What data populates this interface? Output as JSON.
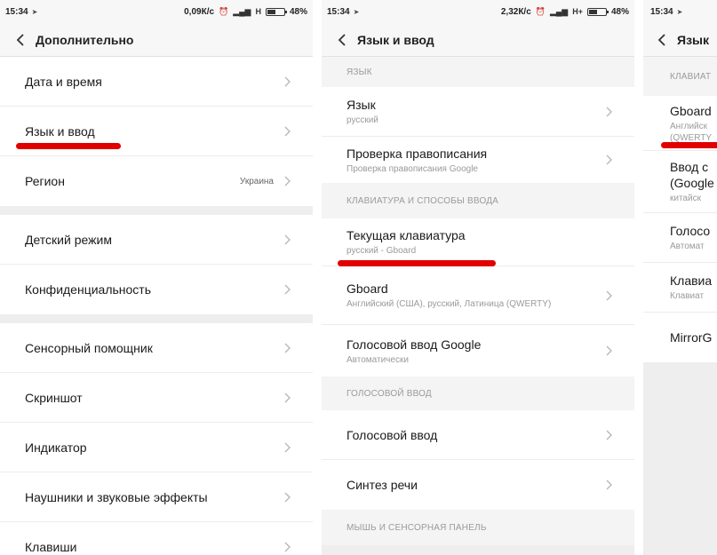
{
  "colors": {
    "accent_underline": "#e00000",
    "background": "#eeeeee",
    "card": "#ffffff"
  },
  "screen1": {
    "status": {
      "time": "15:34",
      "speed": "0,09К/с",
      "network": "H",
      "battery": "48%"
    },
    "title": "Дополнительно",
    "items": [
      {
        "label": "Дата и время"
      },
      {
        "label": "Язык и ввод"
      },
      {
        "label": "Регион",
        "value": "Украина"
      },
      {
        "label": "Детский режим"
      },
      {
        "label": "Конфиденциальность"
      },
      {
        "label": "Сенсорный помощник"
      },
      {
        "label": "Скриншот"
      },
      {
        "label": "Индикатор"
      },
      {
        "label": "Наушники и звуковые эффекты"
      },
      {
        "label": "Клавиши"
      }
    ]
  },
  "screen2": {
    "status": {
      "time": "15:34",
      "speed": "2,32К/с",
      "network": "H+",
      "battery": "48%"
    },
    "title": "Язык и ввод",
    "sections": {
      "language": "ЯЗЫК",
      "keyboards": "КЛАВИАТУРА И СПОСОБЫ ВВОДА",
      "voice": "ГОЛОСОВОЙ ВВОД",
      "mouse": "МЫШЬ И СЕНСОРНАЯ ПАНЕЛЬ"
    },
    "items": {
      "language": {
        "label": "Язык",
        "sub": "русский"
      },
      "spellcheck": {
        "label": "Проверка правописания",
        "sub": "Проверка правописания Google"
      },
      "current_keyboard": {
        "label": "Текущая клавиатура",
        "sub": "русский - Gboard"
      },
      "gboard": {
        "label": "Gboard",
        "sub": "Английский (США), русский, Латиница (QWERTY)"
      },
      "google_voice": {
        "label": "Голосовой ввод Google",
        "sub": "Автоматически"
      },
      "voice_input": {
        "label": "Голосовой ввод"
      },
      "tts": {
        "label": "Синтез речи"
      }
    }
  },
  "screen3": {
    "status": {
      "time": "15:34"
    },
    "title": "Язык",
    "section": "КЛАВИАТ",
    "items": [
      {
        "label": "Gboard",
        "sub1": "Английск",
        "sub2": "(QWERTY"
      },
      {
        "label": "Ввод с",
        "label2": "(Google",
        "sub1": "китайск"
      },
      {
        "label": "Голосо",
        "sub1": "Автомат"
      },
      {
        "label": "Клавиа",
        "sub1": "Клавиат"
      },
      {
        "label": "MirrorG"
      }
    ]
  }
}
